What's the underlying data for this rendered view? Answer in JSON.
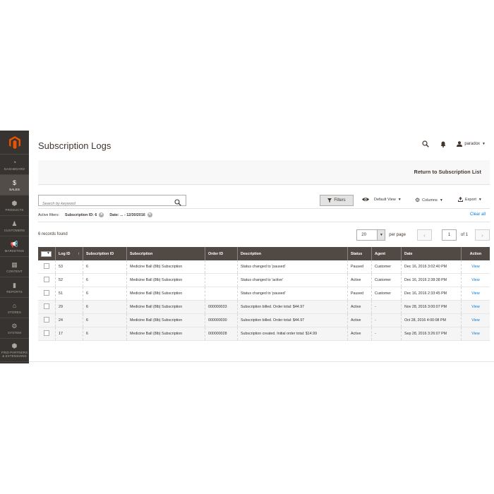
{
  "sidebar": {
    "items": [
      {
        "label": "Dashboard",
        "icon": "dashboard-icon",
        "glyph": "◔"
      },
      {
        "label": "Sales",
        "icon": "dollar-icon",
        "glyph": "$"
      },
      {
        "label": "Products",
        "icon": "cube-icon",
        "glyph": "⬢"
      },
      {
        "label": "Customers",
        "icon": "person-icon",
        "glyph": "♟"
      },
      {
        "label": "Marketing",
        "icon": "megaphone-icon",
        "glyph": "📢"
      },
      {
        "label": "Content",
        "icon": "layout-icon",
        "glyph": "▦"
      },
      {
        "label": "Reports",
        "icon": "bar-chart-icon",
        "glyph": "▮"
      },
      {
        "label": "Stores",
        "icon": "store-icon",
        "glyph": "⌂"
      },
      {
        "label": "System",
        "icon": "gear-icon",
        "glyph": "⚙"
      },
      {
        "label": "Find Partners & Extensions",
        "icon": "box-icon",
        "glyph": "⬢"
      }
    ],
    "active_index": 1
  },
  "header": {
    "title": "Subscription Logs",
    "username": "paradox"
  },
  "actions": {
    "return_label": "Return to Subscription List"
  },
  "toolbar": {
    "search_placeholder": "Search by keyword",
    "filters_label": "Filters",
    "view_label": "Default View",
    "columns_label": "Columns",
    "export_label": "Export"
  },
  "active_filters": {
    "label": "Active filters:",
    "chips": [
      "Subscription ID: 6",
      "Date: ... - 12/30/2016"
    ],
    "clear_label": "Clear all"
  },
  "pagination": {
    "records": "6 records found",
    "per_page_value": "20",
    "per_page_label": "per page",
    "page": "1",
    "of_label": "of 1"
  },
  "table": {
    "columns": [
      "Log ID",
      "Subscription ID",
      "Subscription",
      "Order ID",
      "Description",
      "Status",
      "Agent",
      "Date",
      "Action"
    ],
    "rows": [
      {
        "log_id": "53",
        "sub_id": "6",
        "subscription": "Medicine Ball (8lb) Subscription",
        "order_id": "",
        "description": "Status changed to 'paused'",
        "status": "Paused",
        "agent": "Customer",
        "date": "Dec 16, 2016 3:02:40 PM",
        "action": "View"
      },
      {
        "log_id": "52",
        "sub_id": "6",
        "subscription": "Medicine Ball (8lb) Subscription",
        "order_id": "",
        "description": "Status changed to 'active'",
        "status": "Active",
        "agent": "Customer",
        "date": "Dec 16, 2016 2:38:38 PM",
        "action": "View"
      },
      {
        "log_id": "51",
        "sub_id": "6",
        "subscription": "Medicine Ball (8lb) Subscription",
        "order_id": "",
        "description": "Status changed to 'paused'",
        "status": "Paused",
        "agent": "Customer",
        "date": "Dec 16, 2016 2:33:45 PM",
        "action": "View"
      },
      {
        "log_id": "29",
        "sub_id": "6",
        "subscription": "Medicine Ball (8lb) Subscription",
        "order_id": "000000033",
        "description": "Subscription billed. Order total: $44.97",
        "status": "Active",
        "agent": "-",
        "date": "Nov 28, 2016 3:00:07 PM",
        "action": "View"
      },
      {
        "log_id": "24",
        "sub_id": "6",
        "subscription": "Medicine Ball (8lb) Subscription",
        "order_id": "000000030",
        "description": "Subscription billed. Order total: $44.97",
        "status": "Active",
        "agent": "-",
        "date": "Oct 28, 2016 4:00:08 PM",
        "action": "View"
      },
      {
        "log_id": "17",
        "sub_id": "6",
        "subscription": "Medicine Ball (8lb) Subscription",
        "order_id": "000000028",
        "description": "Subscription created. Initial order total: $14.99",
        "status": "Active",
        "agent": "-",
        "date": "Sep 28, 2016 3:26:07 PM",
        "action": "View"
      }
    ]
  },
  "colors": {
    "sidebar_bg": "#373330",
    "header_bg": "#514943",
    "link": "#007bdb",
    "logo": "#eb5202"
  }
}
